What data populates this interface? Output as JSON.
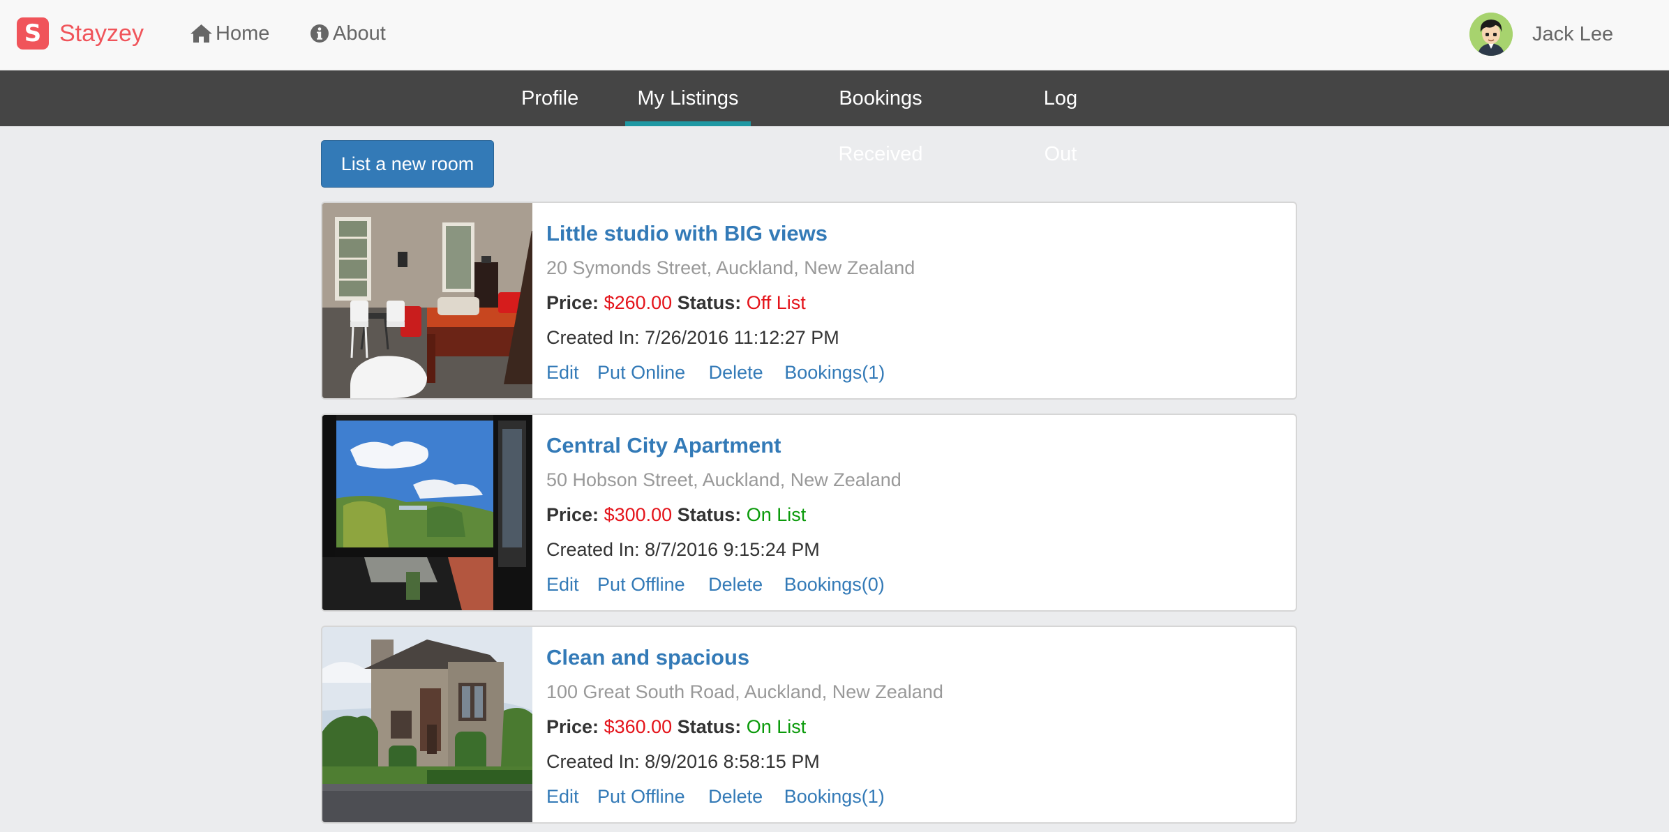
{
  "brand": {
    "logo_letter": "S",
    "name": "Stayzey",
    "color": "#f0545a"
  },
  "nav": {
    "home": {
      "icon": "home-icon",
      "label": "Home"
    },
    "about": {
      "icon": "info-circle-icon",
      "label": "About"
    }
  },
  "user": {
    "name": "Jack Lee",
    "avatar": "avatar-cartoon"
  },
  "subnav": {
    "active": "My Listings",
    "active_color": "#1f98a3",
    "items": [
      "Profile",
      "My Listings",
      "Bookings Received",
      "Log Out"
    ]
  },
  "main": {
    "new_room_button": "List a new room"
  },
  "labels": {
    "price": "Price:",
    "status": "Status:",
    "created_prefix": "Created In: "
  },
  "listings": [
    {
      "title": "Little studio with BIG views",
      "address": "20 Symonds Street, Auckland, New Zealand",
      "price": "$260.00",
      "status": "Off List",
      "created": "7/26/2016 11:12:27 PM",
      "actions": [
        "Edit",
        "Put Online",
        "Delete",
        "Bookings(1)"
      ],
      "image": "bedroom-photo"
    },
    {
      "title": "Central City Apartment",
      "address": "50 Hobson Street, Auckland, New Zealand",
      "price": "$300.00",
      "status": "On List",
      "created": "8/7/2016 9:15:24 PM",
      "actions": [
        "Edit",
        "Put Offline",
        "Delete",
        "Bookings(0)"
      ],
      "image": "window-view-photo"
    },
    {
      "title": "Clean and spacious",
      "address": "100 Great South Road, Auckland, New Zealand",
      "price": "$360.00",
      "status": "On List",
      "created": "8/9/2016 8:58:15 PM",
      "actions": [
        "Edit",
        "Put Offline",
        "Delete",
        "Bookings(1)"
      ],
      "image": "house-exterior-photo"
    }
  ],
  "colors": {
    "link": "#337ab7",
    "price": "#e4131a",
    "status_off": "#e4131a",
    "status_on": "#0a9a0a",
    "subnav_bg": "#454545",
    "page_bg": "#ebecee"
  }
}
